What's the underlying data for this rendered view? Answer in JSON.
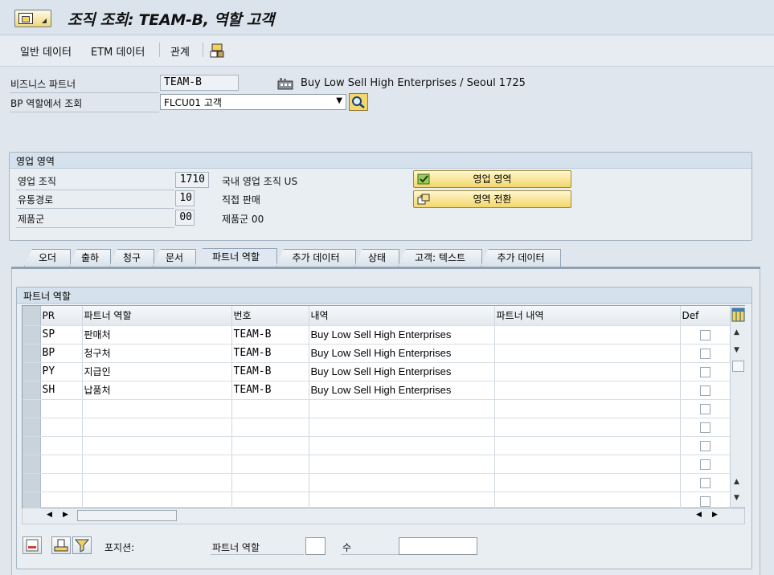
{
  "title": "조직 조회: TEAM-B, 역할 고객",
  "toolbar": {
    "general_data": "일반 데이터",
    "etm_data": "ETM 데이터",
    "relations": "관계"
  },
  "header": {
    "bp_label": "비즈니스 파트너",
    "bp_value": "TEAM-B",
    "bp_desc": "Buy Low Sell High Enterprises / Seoul 1725",
    "role_label": "BP 역할에서 조회",
    "role_value": "FLCU01 고객"
  },
  "sales_area": {
    "title": "영업 영역",
    "org_label": "영업 조직",
    "org_value": "1710",
    "org_desc": "국내 영업 조직 US",
    "channel_label": "유통경로",
    "channel_value": "10",
    "channel_desc": "직접 판매",
    "division_label": "제품군",
    "division_value": "00",
    "division_desc": "제품군 00",
    "btn_sales_area": "영업 영역",
    "btn_switch": "영역 전환"
  },
  "tabs": [
    "오더",
    "출하",
    "청구",
    "문서",
    "파트너 역할",
    "추가 데이터",
    "상태",
    "고객: 텍스트",
    "추가 데이터"
  ],
  "partner_group": {
    "title": "파트너 역할"
  },
  "grid": {
    "headers": {
      "pr": "PR",
      "role": "파트너 역할",
      "number": "번호",
      "desc": "내역",
      "partner_desc": "파트너 내역",
      "def": "Def"
    },
    "rows": [
      {
        "pr": "SP",
        "role": "판매처",
        "number": "TEAM-B",
        "desc": "Buy Low Sell High Enterprises"
      },
      {
        "pr": "BP",
        "role": "청구처",
        "number": "TEAM-B",
        "desc": "Buy Low Sell High Enterprises"
      },
      {
        "pr": "PY",
        "role": "지급인",
        "number": "TEAM-B",
        "desc": "Buy Low Sell High Enterprises"
      },
      {
        "pr": "SH",
        "role": "납품처",
        "number": "TEAM-B",
        "desc": "Buy Low Sell High Enterprises"
      }
    ]
  },
  "footer": {
    "position_label": "포지션:",
    "partner_role_label": "파트너 역할",
    "count_label": "수"
  }
}
